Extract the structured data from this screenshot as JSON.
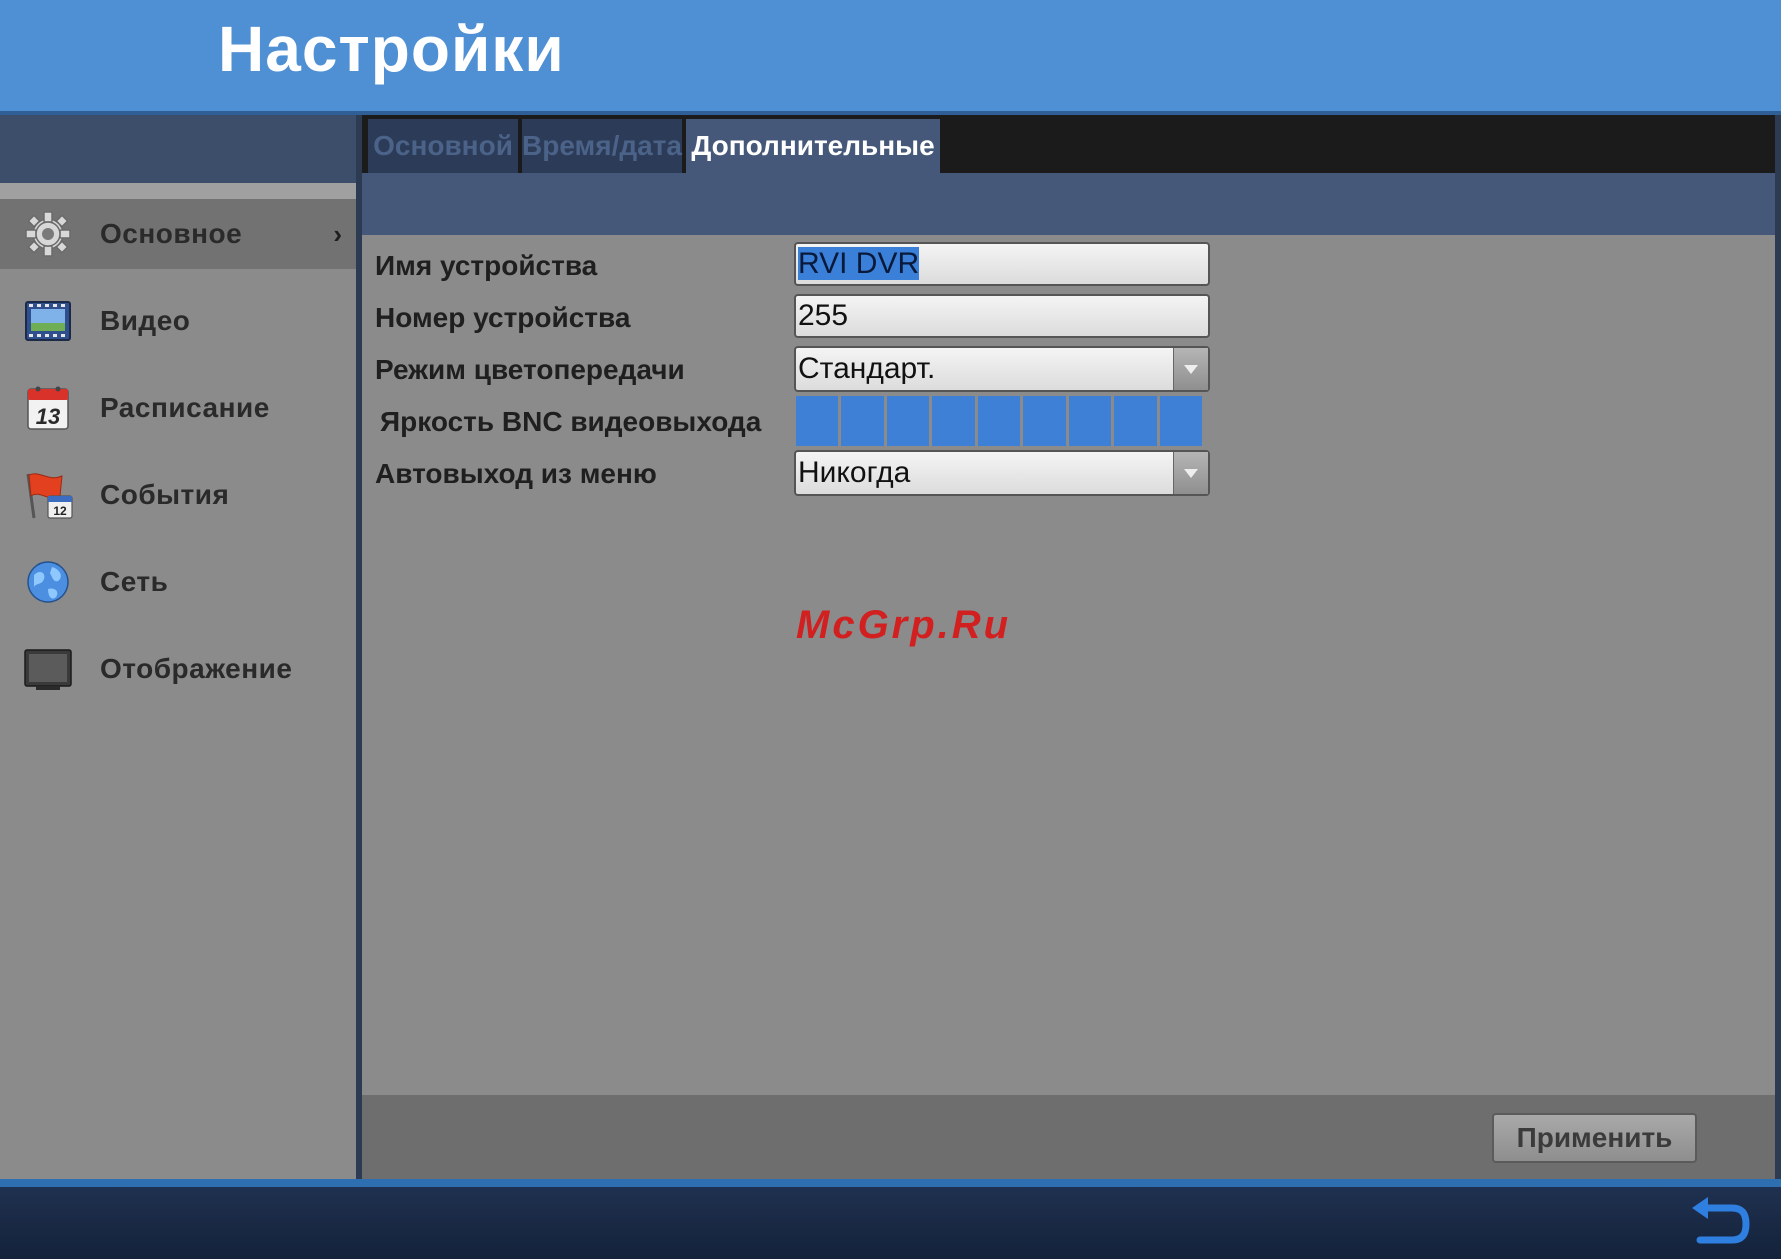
{
  "header": {
    "title": "Настройки"
  },
  "sidebar": {
    "items": [
      {
        "label": "Основное",
        "icon": "gear-icon",
        "active": true,
        "chevron": "›"
      },
      {
        "label": "Видео",
        "icon": "video-icon",
        "active": false
      },
      {
        "label": "Расписание",
        "icon": "calendar-icon",
        "active": false,
        "icon_text": "13"
      },
      {
        "label": "События",
        "icon": "events-flag-icon",
        "active": false,
        "icon_text": "12"
      },
      {
        "label": "Сеть",
        "icon": "network-globe-icon",
        "active": false
      },
      {
        "label": "Отображение",
        "icon": "display-monitor-icon",
        "active": false
      }
    ]
  },
  "tabs": [
    {
      "label": "Основной",
      "active": false
    },
    {
      "label": "Время/дата",
      "active": false
    },
    {
      "label": "Дополнительные",
      "active": true
    }
  ],
  "form": {
    "device_name": {
      "label": "Имя устройства",
      "value": "RVI DVR"
    },
    "device_number": {
      "label": "Номер устройства",
      "value": "255"
    },
    "color_mode": {
      "label": "Режим цветопередачи",
      "value": "Стандарт."
    },
    "bnc_brightness": {
      "label": "Яркость BNC видеовыхода",
      "segments_total": 9,
      "segments_filled": 9
    },
    "menu_timeout": {
      "label": "Автовыход из меню",
      "value": "Никогда"
    }
  },
  "watermark": "McGrp.Ru",
  "apply_label": "Применить",
  "colors": {
    "header_bg": "#4f8fd3",
    "accent_blue": "#3d80d6",
    "panel_gray": "#8b8b8b",
    "tab_active": "#46587a"
  }
}
